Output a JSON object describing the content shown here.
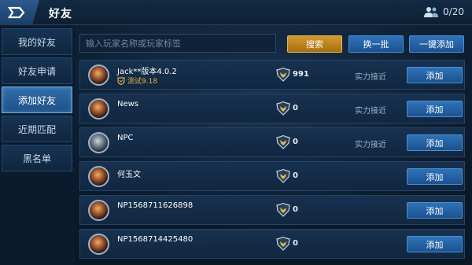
{
  "header": {
    "title": "好友",
    "friend_count": "0/20",
    "back_icon": "back-arrow-icon",
    "friends_icon": "friends-icon"
  },
  "sidebar": {
    "items": [
      {
        "label": "我的好友",
        "active": false
      },
      {
        "label": "好友申请",
        "active": false
      },
      {
        "label": "添加好友",
        "active": true
      },
      {
        "label": "近期匹配",
        "active": false
      },
      {
        "label": "黑名单",
        "active": false
      }
    ]
  },
  "search": {
    "placeholder": "输入玩家名称或玩家标签",
    "value": "",
    "search_label": "搜索",
    "refresh_label": "换一批",
    "add_all_label": "一键添加"
  },
  "players": [
    {
      "name": "Jack**版本4.0.2",
      "tag": "测试9.18",
      "rank": "991",
      "status": "实力接近",
      "add_label": "添加"
    },
    {
      "name": "News",
      "tag": "",
      "rank": "0",
      "status": "实力接近",
      "add_label": "添加"
    },
    {
      "name": "NPC",
      "tag": "",
      "rank": "0",
      "status": "实力接近",
      "add_label": "添加"
    },
    {
      "name": "何玉文",
      "tag": "",
      "rank": "0",
      "status": "",
      "add_label": "添加"
    },
    {
      "name": "NP1568711626898",
      "tag": "",
      "rank": "0",
      "status": "",
      "add_label": "添加"
    },
    {
      "name": "NP1568714425480",
      "tag": "",
      "rank": "0",
      "status": "",
      "add_label": "添加"
    }
  ],
  "colors": {
    "accent_gold": "#d59a2e",
    "button_blue": "#2f73b8",
    "active_tab": "#2f6ea8",
    "tag_gold": "#e0b24a"
  }
}
